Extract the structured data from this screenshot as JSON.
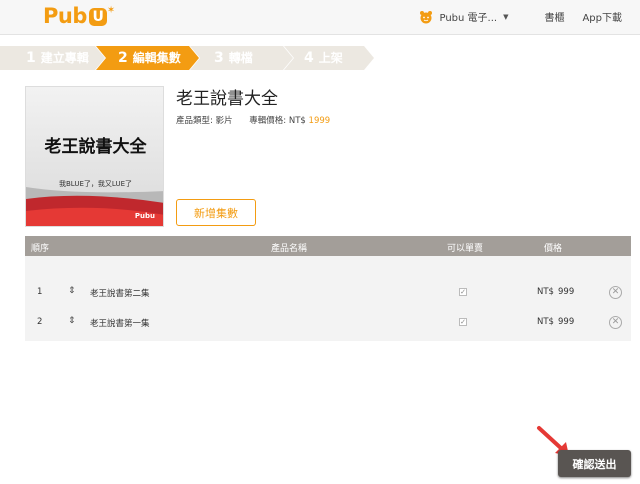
{
  "header": {
    "logo_text": "Pubu",
    "user_label": "Pubu 電子...",
    "nav_links": [
      "書櫃",
      "App下載"
    ]
  },
  "steps": [
    {
      "num": "1",
      "label": "建立專輯",
      "active": false
    },
    {
      "num": "2",
      "label": "編輯集數",
      "active": true
    },
    {
      "num": "3",
      "label": "轉檔",
      "active": false
    },
    {
      "num": "4",
      "label": "上架",
      "active": false
    }
  ],
  "product": {
    "cover_title": "老王說書大全",
    "cover_subtitle": "我BLUE了，我又LUE了",
    "cover_brand": "Pubu",
    "title": "老王說書大全",
    "type_label": "產品類型:",
    "type_value": "影片",
    "price_label": "專輯價格:",
    "price_currency": "NT$",
    "price_value": "1999",
    "add_button": "新增集數"
  },
  "table": {
    "headers": {
      "order": "順序",
      "name": "產品名稱",
      "single_sale": "可以單賣",
      "price": "價格"
    },
    "rows": [
      {
        "order": "1",
        "name": "老王說書第二集",
        "currency": "NT$",
        "price": "999",
        "single_sale": true
      },
      {
        "order": "2",
        "name": "老王說書第一集",
        "currency": "NT$",
        "price": "999",
        "single_sale": true
      }
    ]
  },
  "confirm_button": "確認送出",
  "colors": {
    "accent": "#f39c12",
    "step_active": "#f39c12",
    "step_inactive": "#ece8e1",
    "table_header": "#a39e99",
    "confirm": "#595552",
    "arrow": "#e53935"
  }
}
